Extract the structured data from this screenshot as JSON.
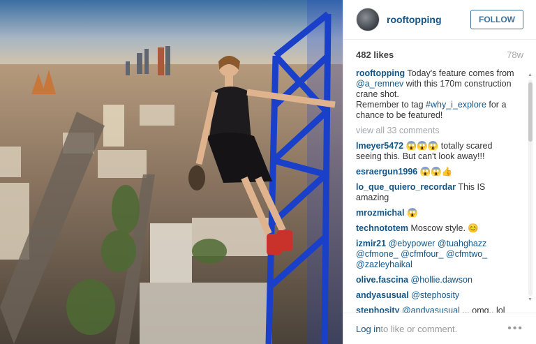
{
  "post": {
    "username": "rooftopping",
    "follow_label": "FOLLOW",
    "likes": "482 likes",
    "time_ago": "78w",
    "caption": {
      "username": "rooftopping",
      "text_1": "Today's feature comes from ",
      "mention": "@a_remnev",
      "text_2": " with this 170m construction crane shot.",
      "text_3": "Remember to tag ",
      "hashtag": "#why_i_explore",
      "text_4": " for a chance to be featured!"
    },
    "view_all": "view all 33 comments",
    "comments": [
      {
        "user": "lmeyer5472",
        "text": " 😱😱😱 totally scared seeing this. But can't look away!!!"
      },
      {
        "user": "esraergun1996",
        "text": " 😱😱👍"
      },
      {
        "user": "lo_que_quiero_recordar",
        "text": " This IS amazing"
      },
      {
        "user": "mrozmichal",
        "text": " 😱"
      },
      {
        "user": "technototem",
        "text": " Moscow style. 😊"
      },
      {
        "user": "izmir21",
        "mentions": " @ebypower @tuahghazz @cfmone_ @cfmfour_ @cfmtwo_ @zazleyhaikal"
      },
      {
        "user": "olive.fascina",
        "mentions": " @hollie.dawson"
      },
      {
        "user": "andyasusual",
        "mentions": " @stephosity"
      },
      {
        "user": "stephosity",
        "mention": " @andyasusual",
        "text": " ... omg.. lol"
      }
    ],
    "footer": {
      "login": "Log in",
      "rest": " to like or comment.",
      "more": "•••"
    }
  },
  "colors": {
    "link": "#125688",
    "follow": "#3f729b",
    "crane": "#1a3fc9"
  },
  "icons": {
    "avatar": "user-avatar",
    "more": "more-options-icon"
  }
}
